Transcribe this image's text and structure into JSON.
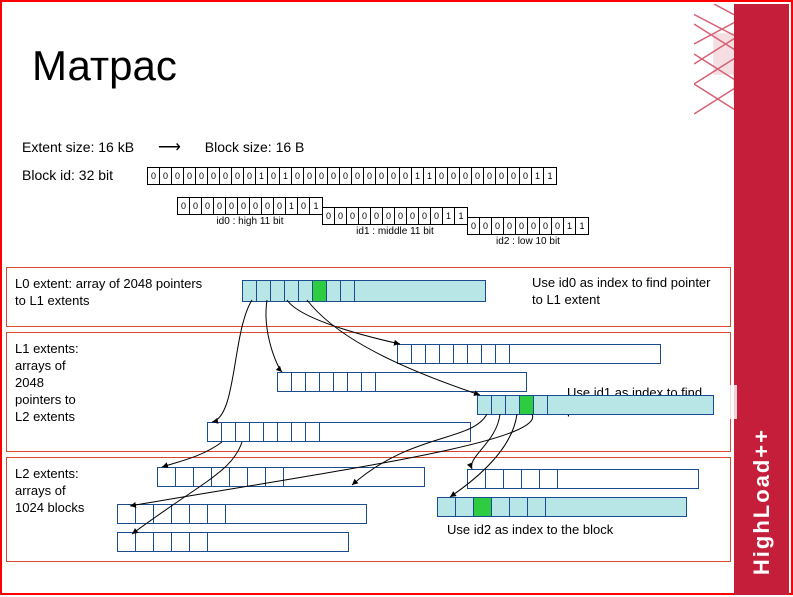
{
  "title": "Матрас",
  "extent_size": "Extent size: 16 kB",
  "block_size": "Block size: 16 B",
  "block_id": "Block id: 32 bit",
  "bits32": [
    "0",
    "0",
    "0",
    "0",
    "0",
    "0",
    "0",
    "0",
    "0",
    "1",
    "0",
    "1",
    "0",
    "0",
    "0",
    "0",
    "0",
    "0",
    "0",
    "0",
    "0",
    "0",
    "1",
    "1",
    "0",
    "0",
    "0",
    "0",
    "0",
    "0",
    "0",
    "0",
    "1",
    "1"
  ],
  "id0_bits": [
    "0",
    "0",
    "0",
    "0",
    "0",
    "0",
    "0",
    "0",
    "0",
    "1",
    "0",
    "1"
  ],
  "id0_label": "id0 : high 11 bit",
  "id1_bits": [
    "0",
    "0",
    "0",
    "0",
    "0",
    "0",
    "0",
    "0",
    "0",
    "0",
    "1",
    "1"
  ],
  "id1_label": "id1 : middle 11 bit",
  "id2_bits": [
    "0",
    "0",
    "0",
    "0",
    "0",
    "0",
    "0",
    "0",
    "1",
    "1"
  ],
  "id2_label": "id2 : low 10 bit",
  "l0_text": "L0 extent: array of 2048 pointers to L1 extents",
  "l1_text": "L1 extents:\narrays of\n2048\npointers to\nL2 extents",
  "l2_text": "L2 extents:\narrays of\n1024 blocks",
  "use0": "Use id0 as index to find pointer to L1 extent",
  "use1": "Use id1 as index to find pointer to L2 extent",
  "use2": "Use id2 as index to the block",
  "brand": "HighLoad++"
}
